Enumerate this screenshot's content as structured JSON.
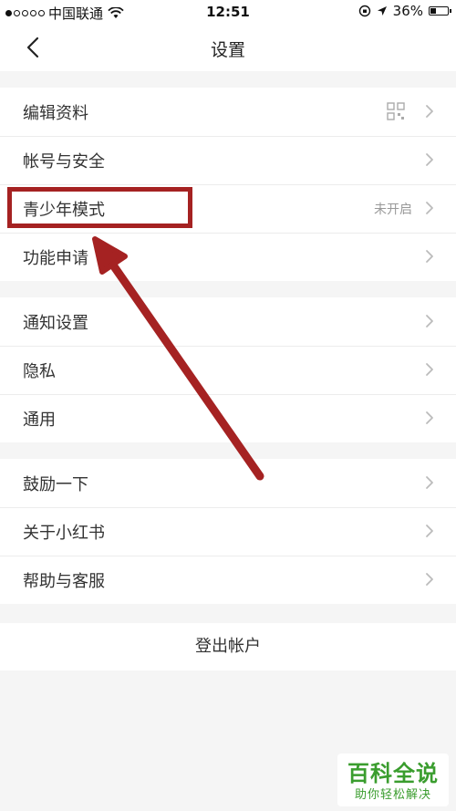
{
  "status_bar": {
    "carrier": "中国联通",
    "time": "12:51",
    "battery": "36%"
  },
  "nav": {
    "title": "设置",
    "back_icon": "chevron-left-icon"
  },
  "groups": [
    {
      "items": [
        {
          "label": "编辑资料",
          "icon": "qr-code-icon"
        },
        {
          "label": "帐号与安全"
        },
        {
          "label": "青少年模式",
          "value": "未开启"
        },
        {
          "label": "功能申请"
        }
      ]
    },
    {
      "items": [
        {
          "label": "通知设置"
        },
        {
          "label": "隐私"
        },
        {
          "label": "通用"
        }
      ]
    },
    {
      "items": [
        {
          "label": "鼓励一下"
        },
        {
          "label": "关于小红书"
        },
        {
          "label": "帮助与客服"
        }
      ]
    }
  ],
  "logout_label": "登出帐户",
  "annotation": {
    "color": "#a52222",
    "target": "青少年模式"
  },
  "watermark": {
    "title": "百科全说",
    "subtitle": "助你轻松解决",
    "color": "#3a9d2e"
  }
}
